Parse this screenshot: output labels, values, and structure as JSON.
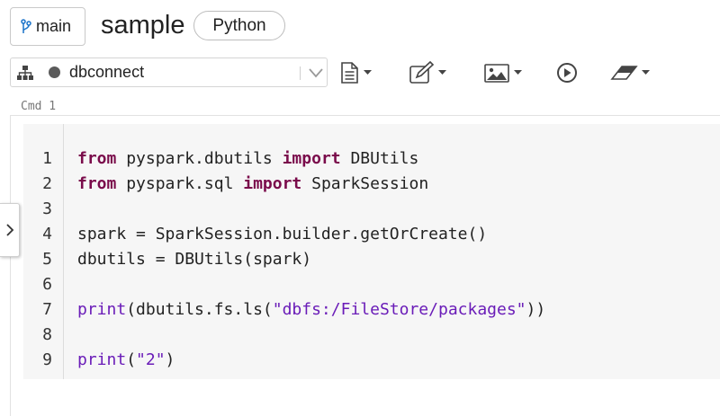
{
  "header": {
    "branch": {
      "icon": "git-branch-icon",
      "label": "main"
    },
    "notebook_title": "sample",
    "language": "Python"
  },
  "toolbar": {
    "cluster": {
      "icon": "cluster-tree-icon",
      "status_icon": "status-dot-icon",
      "name": "dbconnect",
      "dropdown_icon": "chevron-down-icon"
    },
    "buttons": [
      {
        "icon": "file-icon"
      },
      {
        "icon": "edit-icon"
      },
      {
        "icon": "image-icon"
      },
      {
        "icon": "run-icon"
      },
      {
        "icon": "eraser-icon"
      }
    ]
  },
  "cell": {
    "label": "Cmd  1",
    "lines": [
      {
        "num": "1"
      },
      {
        "num": "2"
      },
      {
        "num": "3"
      },
      {
        "num": "4"
      },
      {
        "num": "5"
      },
      {
        "num": "6"
      },
      {
        "num": "7"
      },
      {
        "num": "8"
      },
      {
        "num": "9"
      }
    ],
    "code": {
      "l1": {
        "kw1": "from",
        "a": " pyspark.dbutils ",
        "kw2": "import",
        "b": " DBUtils"
      },
      "l2": {
        "kw1": "from",
        "a": " pyspark.sql ",
        "kw2": "import",
        "b": " SparkSession"
      },
      "l4": {
        "text": "spark = SparkSession.builder.getOrCreate()"
      },
      "l5": {
        "text": "dbutils = DBUtils(spark)"
      },
      "l7": {
        "fn": "print",
        "a": "(dbutils.fs.ls(",
        "str": "\"dbfs:/FileStore/packages\"",
        "b": "))"
      },
      "l9": {
        "fn": "print",
        "a": "(",
        "str": "\"2\"",
        "b": ")"
      }
    }
  },
  "sidebar_toggle": {
    "icon": "chevron-right-icon"
  },
  "colors": {
    "keyword": "#7a0b4b",
    "function": "#6a1cb8",
    "string": "#6a1cb8",
    "editor_bg": "#f6f6f6"
  }
}
